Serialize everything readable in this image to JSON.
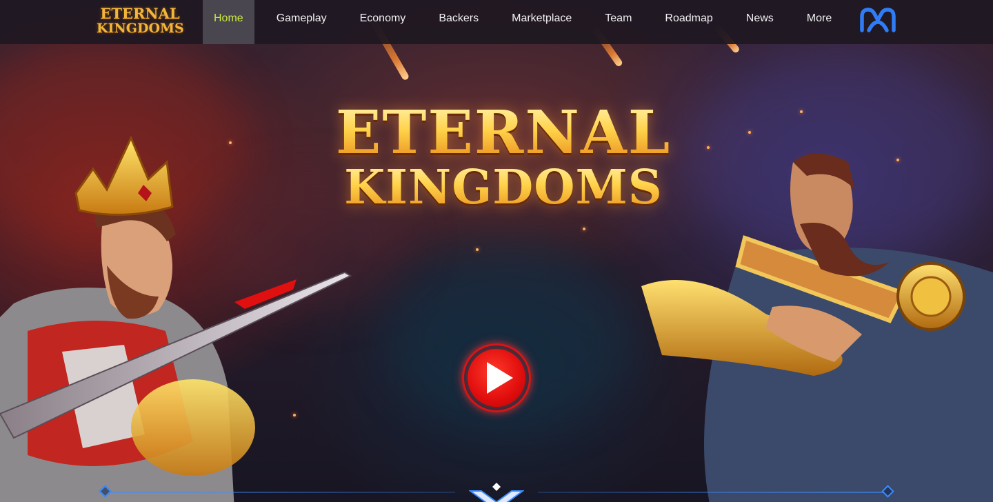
{
  "nav": {
    "logo": {
      "line1": "ETERNAL",
      "line2": "KINGDOMS"
    },
    "items": [
      {
        "label": "Home",
        "active": true
      },
      {
        "label": "Gameplay",
        "active": false
      },
      {
        "label": "Economy",
        "active": false
      },
      {
        "label": "Backers",
        "active": false
      },
      {
        "label": "Marketplace",
        "active": false
      },
      {
        "label": "Team",
        "active": false
      },
      {
        "label": "Roadmap",
        "active": false
      },
      {
        "label": "News",
        "active": false
      },
      {
        "label": "More",
        "active": false
      }
    ],
    "brand_icon": "mobox-logo-icon"
  },
  "hero": {
    "title_line1": "ETERNAL",
    "title_line2": "KINGDOMS",
    "play_icon": "play-icon"
  },
  "colors": {
    "active_nav_text": "#c9e93a",
    "title_gold": "#ffcf4a",
    "play_red": "#e00d0d",
    "accent_blue": "#2f7cf6"
  }
}
